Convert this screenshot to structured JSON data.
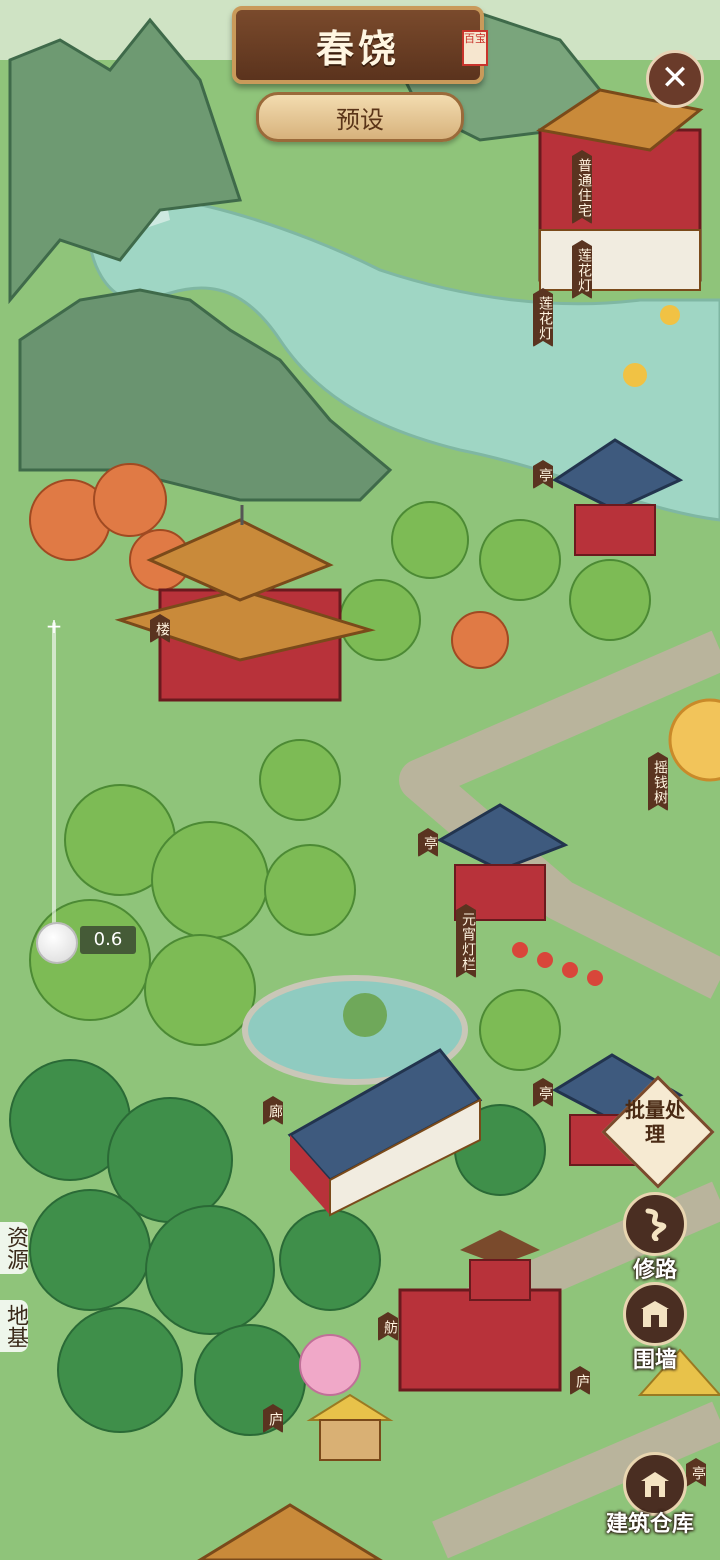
{
  "header": {
    "title": "春饶",
    "seal": "百宝",
    "preset_label": "预设",
    "close_label": "✕"
  },
  "zoom": {
    "value_label": "0.6",
    "level": 0.6
  },
  "side_tabs": [
    {
      "label": "资源"
    },
    {
      "label": "地基"
    }
  ],
  "building_tags": [
    {
      "label": "普通住宅"
    },
    {
      "label": "莲花灯"
    },
    {
      "label": "莲花灯"
    },
    {
      "label": "亭"
    },
    {
      "label": "楼"
    },
    {
      "label": "摇钱树"
    },
    {
      "label": "亭"
    },
    {
      "label": "元宵灯栏"
    },
    {
      "label": "亭"
    },
    {
      "label": "廊"
    },
    {
      "label": "舫"
    },
    {
      "label": "庐"
    },
    {
      "label": "庐"
    },
    {
      "label": "亭"
    }
  ],
  "tools": {
    "batch_label": "批量处理",
    "road_label": "修路",
    "wall_label": "围墙",
    "storage_label": "建筑仓库"
  },
  "colors": {
    "water": "#9fd6c4",
    "grass": "#8fc47a",
    "mountain": "#6e9a72",
    "banner": "#6a3d22",
    "path": "#b9b49c"
  }
}
